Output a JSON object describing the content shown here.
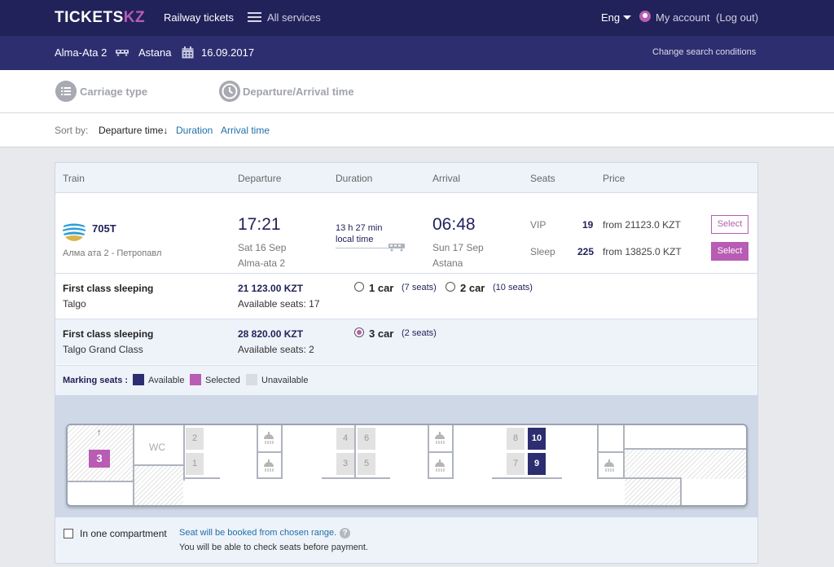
{
  "header": {
    "logo_main": "TICKETS",
    "logo_accent": "KZ",
    "nav_railway": "Railway tickets",
    "nav_all": "All services",
    "lang": "Eng",
    "account": "My account",
    "logout": "(Log out)"
  },
  "route": {
    "from": "Alma-Ata 2",
    "to": "Astana",
    "date": "16.09.2017",
    "change": "Change search conditions"
  },
  "filters": {
    "carriage_type": "Carriage type",
    "time": "Departure/Arrival time"
  },
  "sort": {
    "label": "Sort by:",
    "departure": "Departure time↓",
    "duration": "Duration",
    "arrival": "Arrival time"
  },
  "table_headers": {
    "train": "Train",
    "departure": "Departure",
    "duration": "Duration",
    "arrival": "Arrival",
    "seats": "Seats",
    "price": "Price"
  },
  "train": {
    "number": "705T",
    "route": "Алма ата 2 - Петропавл",
    "dep_time": "17:21",
    "dep_date": "Sat 16 Sep",
    "dep_station": "Alma-ata 2",
    "duration": "13 h 27 min",
    "duration_note": "local time",
    "arr_time": "06:48",
    "arr_date": "Sun 17 Sep",
    "arr_station": "Astana",
    "classes": [
      {
        "name": "VIP",
        "seats": "19",
        "price": "from 21123.0 KZT",
        "button": "Select"
      },
      {
        "name": "Sleep",
        "seats": "225",
        "price": "from 13825.0 KZT",
        "button": "Select"
      }
    ]
  },
  "car_classes": [
    {
      "name": "First class sleeping",
      "sub": "Talgo",
      "price": "21 123.00 KZT",
      "avail": "Available seats: 17",
      "cars": [
        {
          "label": "1 car",
          "seats": "(7 seats)",
          "selected": false
        },
        {
          "label": "2 car",
          "seats": "(10 seats)",
          "selected": false
        }
      ]
    },
    {
      "name": "First class sleeping",
      "sub": "Talgo Grand Class",
      "price": "28 820.00 KZT",
      "avail": "Available seats: 2",
      "cars": [
        {
          "label": "3 car",
          "seats": "(2 seats)",
          "selected": true
        }
      ]
    }
  ],
  "legend": {
    "title": "Marking seats :",
    "available": "Available",
    "selected": "Selected",
    "unavailable": "Unavailable",
    "colors": {
      "available": "#2d2e70",
      "selected": "#b85cb4",
      "unavailable": "#d9dce3"
    }
  },
  "wagon": {
    "car_number": "3",
    "wc": "WC",
    "arrow": "↑",
    "seats": [
      "2",
      "1",
      "4",
      "3",
      "6",
      "5",
      "8",
      "7",
      "10",
      "9"
    ]
  },
  "footer": {
    "checkbox_label": "In one compartment",
    "note1": "Seat will be booked from chosen range.",
    "q": "?",
    "note2": "You will be able to check seats before payment."
  }
}
